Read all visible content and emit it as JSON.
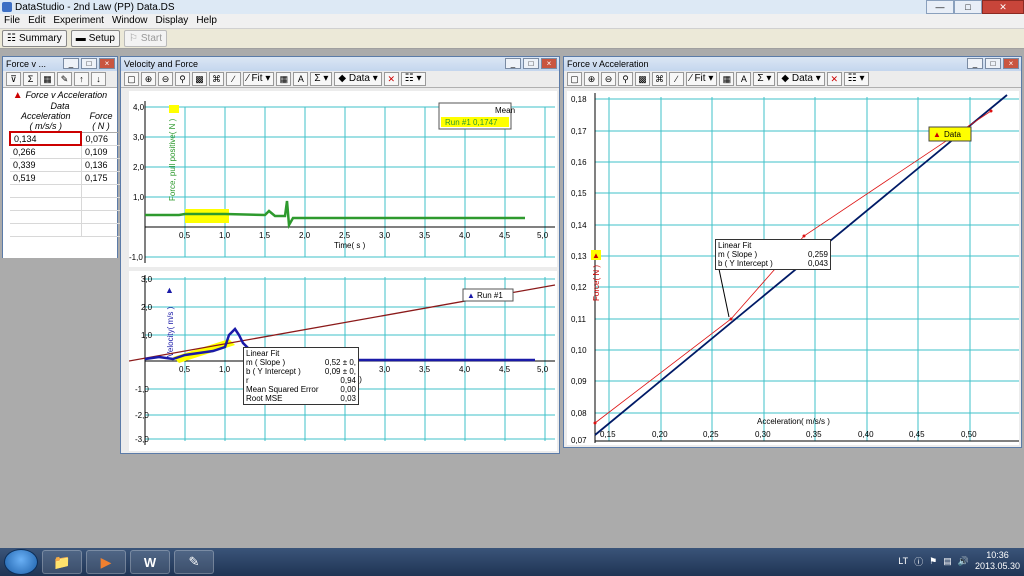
{
  "app": {
    "title": "DataStudio - 2nd Law (PP) Data.DS",
    "menus": [
      "File",
      "Edit",
      "Experiment",
      "Window",
      "Display",
      "Help"
    ],
    "toolbar": {
      "summary": "Summary",
      "setup": "Setup",
      "start": "Start"
    }
  },
  "table_window": {
    "title": "Force v ...",
    "header1": "Force v Acceleration",
    "header2": "Data",
    "col1_head": "Acceleration",
    "col1_unit": "( m/s/s )",
    "col2_head": "Force",
    "col2_unit": "( N )",
    "rows": [
      {
        "a": "0,134",
        "f": "0,076"
      },
      {
        "a": "0,266",
        "f": "0,109"
      },
      {
        "a": "0,339",
        "f": "0,136"
      },
      {
        "a": "0,519",
        "f": "0,175"
      }
    ]
  },
  "vf_window": {
    "title": "Velocity and Force",
    "fit_label": "Fit",
    "data_label": "Data",
    "force_graph": {
      "ylabel": "Force, pull positive( N )",
      "xlabel": "Time( s )",
      "yticks": [
        "4,0",
        "3,0",
        "2,0",
        "1,0",
        "-1,0"
      ],
      "xticks": [
        "0,5",
        "1,0",
        "1,5",
        "2,0",
        "2,5",
        "3,0",
        "3,5",
        "4,0",
        "4,5",
        "5,0"
      ],
      "legend_title": "Mean",
      "legend_entry": "Run #1  0,1747"
    },
    "velocity_graph": {
      "ylabel": "Velocity( m/s )",
      "xlabel": "s )",
      "yticks": [
        "3,0",
        "2,0",
        "1,0",
        "-1,0",
        "-2,0",
        "-3,0"
      ],
      "xticks": [
        "0,5",
        "1,0",
        "3,0",
        "3,5",
        "4,0",
        "4,5",
        "5,0"
      ],
      "legend": "Run #1",
      "fit_box": {
        "title": "Linear Fit",
        "rows": [
          {
            "k": "m ( Slope )",
            "v": "0,52 ± 0,"
          },
          {
            "k": "b ( Y Intercept )",
            "v": "0,09 ± 0,"
          },
          {
            "k": "r",
            "v": "0,94"
          },
          {
            "k": "Mean Squared Error",
            "v": "0,00"
          },
          {
            "k": "Root MSE",
            "v": "0,03"
          }
        ]
      }
    }
  },
  "fa_window": {
    "title": "Force v Acceleration",
    "fit_label": "Fit",
    "data_label": "Data",
    "ylabel": "Force( N )",
    "xlabel": "Acceleration( m/s/s )",
    "yticks": [
      "0,18",
      "0,17",
      "0,16",
      "0,15",
      "0,14",
      "0,13",
      "0,12",
      "0,11",
      "0,10",
      "0,09",
      "0,08",
      "0,07"
    ],
    "xticks": [
      "0,15",
      "0,20",
      "0,25",
      "0,30",
      "0,35",
      "0,40",
      "0,45",
      "0,50"
    ],
    "legend": "Data",
    "fit_box": {
      "title": "Linear Fit",
      "rows": [
        {
          "k": "m ( Slope )",
          "v": "0,259"
        },
        {
          "k": "b ( Y Intercept )",
          "v": "0,043"
        }
      ]
    }
  },
  "tray": {
    "lang": "LT",
    "time": "10:36",
    "date": "2013.05.30"
  },
  "colors": {
    "grid": "#3fc2c8",
    "force": "#2e9a2e",
    "velocity": "#1a1aa8",
    "fit": "#8b1a1a",
    "highlight": "#ffff00"
  }
}
